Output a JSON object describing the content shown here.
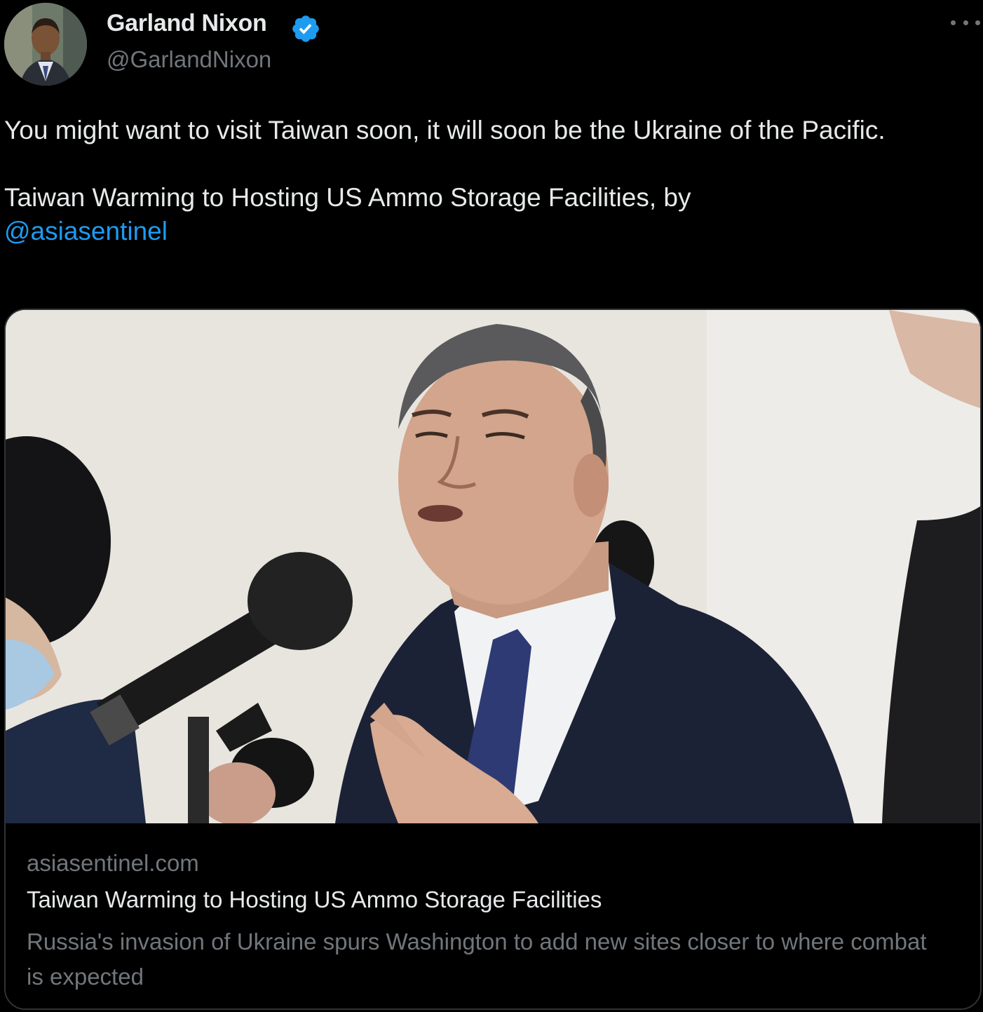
{
  "tweet": {
    "author": {
      "name": "Garland Nixon",
      "handle": "@GarlandNixon",
      "verified": true,
      "avatar_icon": "profile-photo"
    },
    "text_line1": "You might want to visit Taiwan soon, it will soon be the Ukraine of the Pacific.",
    "text_line2": "Taiwan Warming to Hosting US Ammo Storage Facilities, by",
    "mention": "@asiasentinel",
    "more_icon": "ellipsis-icon"
  },
  "card": {
    "image_icon": "article-photo",
    "domain": "asiasentinel.com",
    "title": "Taiwan Warming to Hosting US Ammo Storage Facilities",
    "description": "Russia's invasion of Ukraine spurs Washington to add new sites closer to where combat is expected"
  },
  "colors": {
    "background": "#000000",
    "text_primary": "#e7e9ea",
    "text_secondary": "#71767b",
    "link": "#1d9bf0",
    "verified": "#1d9bf0",
    "border": "#2f3336"
  }
}
